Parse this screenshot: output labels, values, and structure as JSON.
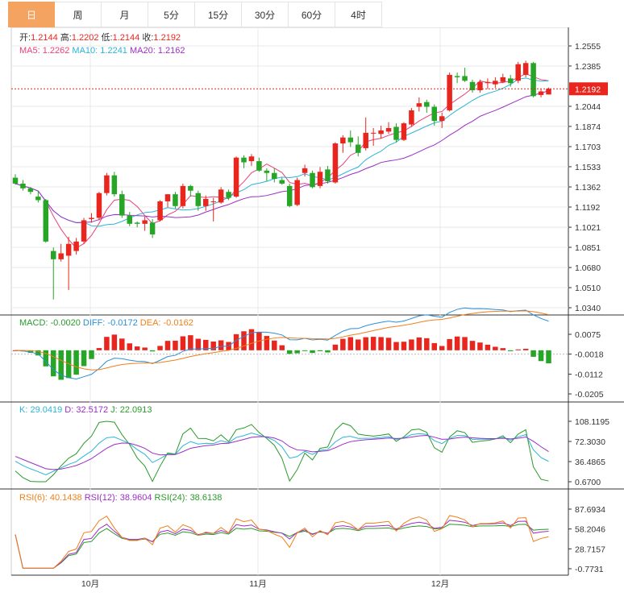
{
  "tabs": [
    "日",
    "周",
    "月",
    "5分",
    "15分",
    "30分",
    "60分",
    "4时"
  ],
  "active_tab": 0,
  "price_panel": {
    "ohlc_line": [
      {
        "label": "开:",
        "value": "1.2144"
      },
      {
        "label": "高:",
        "value": "1.2202"
      },
      {
        "label": "低:",
        "value": "1.2144"
      },
      {
        "label": "收:",
        "value": "1.2192"
      }
    ],
    "ma_line": [
      {
        "label": "MA5: 1.2262",
        "color": "#e8417b"
      },
      {
        "label": "MA10: 1.2241",
        "color": "#2bb5d6"
      },
      {
        "label": "MA20: 1.2162",
        "color": "#9b2fc4"
      }
    ],
    "last_price": "1.2192",
    "y_ticks": [
      "1.2555",
      "1.2385",
      "1.2044",
      "1.1874",
      "1.1703",
      "1.1533",
      "1.1362",
      "1.1192",
      "1.1021",
      "1.0851",
      "1.0680",
      "1.0510",
      "1.0340"
    ]
  },
  "macd_panel": {
    "legend": [
      {
        "label": "MACD: -0.0020",
        "color": "#2a9a2a"
      },
      {
        "label": "DIFF: -0.0172",
        "color": "#2b8fd6"
      },
      {
        "label": "DEA: -0.0162",
        "color": "#f07f1a"
      }
    ],
    "y_ticks": [
      "0.0075",
      "-0.0018",
      "-0.0112",
      "-0.0205"
    ]
  },
  "kdj_panel": {
    "legend": [
      {
        "label": "K: 29.0419",
        "color": "#2bb5d6"
      },
      {
        "label": "D: 32.5172",
        "color": "#9b2fc4"
      },
      {
        "label": "J: 22.0913",
        "color": "#2a9a2a"
      }
    ],
    "y_ticks": [
      "108.1195",
      "72.3030",
      "36.4865",
      "0.6700"
    ]
  },
  "rsi_panel": {
    "legend": [
      {
        "label": "RSI(6): 40.1438",
        "color": "#f07f1a"
      },
      {
        "label": "RSI(12): 38.9604",
        "color": "#9b2fc4"
      },
      {
        "label": "RSI(24): 38.6138",
        "color": "#2a9a2a"
      }
    ],
    "y_ticks": [
      "87.6934",
      "58.2046",
      "28.7157",
      "-0.7731"
    ]
  },
  "x_axis_labels": [
    "10月",
    "11月",
    "12月"
  ],
  "colors": {
    "up": "#e8261e",
    "down": "#26a526",
    "grid": "#e8e8e8",
    "active_tab": "#f4a460"
  },
  "chart_data": {
    "type": "candlestick",
    "ylim": [
      1.034,
      1.2555
    ],
    "candles": [
      [
        1.144,
        1.147,
        1.138,
        1.139
      ],
      [
        1.139,
        1.142,
        1.133,
        1.135
      ],
      [
        1.135,
        1.136,
        1.13,
        1.132
      ],
      [
        1.128,
        1.133,
        1.123,
        1.125
      ],
      [
        1.125,
        1.126,
        1.089,
        1.09
      ],
      [
        1.082,
        1.085,
        1.041,
        1.075
      ],
      [
        1.075,
        1.088,
        1.073,
        1.08
      ],
      [
        1.078,
        1.094,
        1.049,
        1.088
      ],
      [
        1.082,
        1.093,
        1.079,
        1.09
      ],
      [
        1.09,
        1.11,
        1.088,
        1.108
      ],
      [
        1.109,
        1.114,
        1.106,
        1.11
      ],
      [
        1.11,
        1.132,
        1.108,
        1.131
      ],
      [
        1.131,
        1.148,
        1.129,
        1.146
      ],
      [
        1.146,
        1.149,
        1.128,
        1.13
      ],
      [
        1.13,
        1.133,
        1.11,
        1.112
      ],
      [
        1.112,
        1.115,
        1.103,
        1.105
      ],
      [
        1.106,
        1.107,
        1.102,
        1.105
      ],
      [
        1.105,
        1.111,
        1.099,
        1.108
      ],
      [
        1.106,
        1.109,
        1.093,
        1.096
      ],
      [
        1.108,
        1.125,
        1.107,
        1.124
      ],
      [
        1.124,
        1.13,
        1.119,
        1.13
      ],
      [
        1.13,
        1.132,
        1.118,
        1.12
      ],
      [
        1.12,
        1.139,
        1.118,
        1.137
      ],
      [
        1.137,
        1.138,
        1.128,
        1.133
      ],
      [
        1.131,
        1.133,
        1.116,
        1.12
      ],
      [
        1.12,
        1.129,
        1.116,
        1.126
      ],
      [
        1.124,
        1.127,
        1.107,
        1.124
      ],
      [
        1.123,
        1.136,
        1.122,
        1.134
      ],
      [
        1.132,
        1.134,
        1.125,
        1.127
      ],
      [
        1.128,
        1.162,
        1.127,
        1.161
      ],
      [
        1.161,
        1.163,
        1.152,
        1.157
      ],
      [
        1.158,
        1.164,
        1.154,
        1.162
      ],
      [
        1.158,
        1.161,
        1.149,
        1.15
      ],
      [
        1.15,
        1.152,
        1.141,
        1.148
      ],
      [
        1.148,
        1.152,
        1.14,
        1.143
      ],
      [
        1.142,
        1.144,
        1.138,
        1.139
      ],
      [
        1.137,
        1.139,
        1.119,
        1.12
      ],
      [
        1.121,
        1.144,
        1.12,
        1.142
      ],
      [
        1.148,
        1.155,
        1.145,
        1.152
      ],
      [
        1.148,
        1.15,
        1.135,
        1.136
      ],
      [
        1.137,
        1.153,
        1.135,
        1.149
      ],
      [
        1.151,
        1.154,
        1.139,
        1.141
      ],
      [
        1.14,
        1.174,
        1.139,
        1.173
      ],
      [
        1.173,
        1.18,
        1.165,
        1.178
      ],
      [
        1.178,
        1.184,
        1.17,
        1.174
      ],
      [
        1.172,
        1.179,
        1.162,
        1.165
      ],
      [
        1.169,
        1.195,
        1.167,
        1.182
      ],
      [
        1.182,
        1.186,
        1.171,
        1.182
      ],
      [
        1.181,
        1.188,
        1.177,
        1.184
      ],
      [
        1.183,
        1.191,
        1.181,
        1.186
      ],
      [
        1.187,
        1.19,
        1.174,
        1.176
      ],
      [
        1.176,
        1.191,
        1.175,
        1.19
      ],
      [
        1.189,
        1.203,
        1.187,
        1.201
      ],
      [
        1.204,
        1.212,
        1.2,
        1.207
      ],
      [
        1.208,
        1.21,
        1.199,
        1.204
      ],
      [
        1.204,
        1.206,
        1.188,
        1.192
      ],
      [
        1.192,
        1.199,
        1.186,
        1.196
      ],
      [
        1.201,
        1.233,
        1.2,
        1.231
      ],
      [
        1.23,
        1.233,
        1.224,
        1.229
      ],
      [
        1.23,
        1.237,
        1.225,
        1.226
      ],
      [
        1.225,
        1.227,
        1.216,
        1.218
      ],
      [
        1.218,
        1.227,
        1.216,
        1.225
      ],
      [
        1.224,
        1.228,
        1.219,
        1.225
      ],
      [
        1.223,
        1.229,
        1.22,
        1.226
      ],
      [
        1.225,
        1.232,
        1.224,
        1.229
      ],
      [
        1.228,
        1.231,
        1.221,
        1.224
      ],
      [
        1.226,
        1.242,
        1.224,
        1.24
      ],
      [
        1.231,
        1.243,
        1.229,
        1.241
      ],
      [
        1.241,
        1.242,
        1.212,
        1.213
      ],
      [
        1.214,
        1.219,
        1.212,
        1.217
      ],
      [
        1.2144,
        1.2202,
        1.2144,
        1.2192
      ]
    ]
  }
}
